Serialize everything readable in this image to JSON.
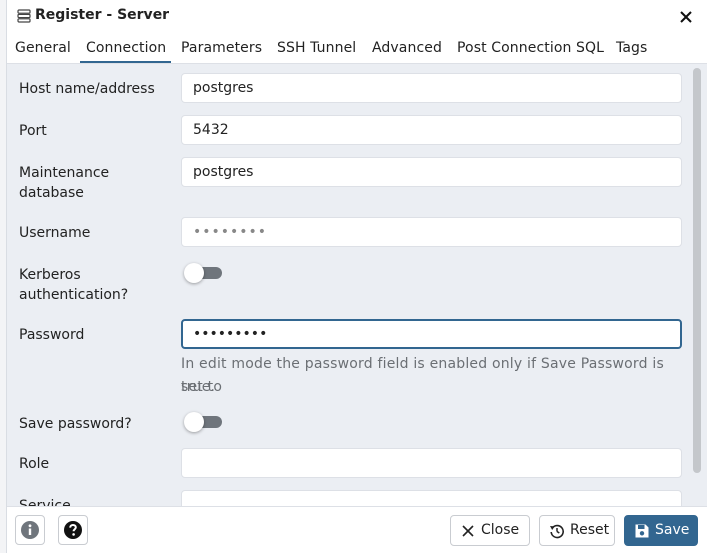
{
  "dialog": {
    "title": "Register - Server"
  },
  "tabs": [
    {
      "label": "General"
    },
    {
      "label": "Connection"
    },
    {
      "label": "Parameters"
    },
    {
      "label": "SSH Tunnel"
    },
    {
      "label": "Advanced"
    },
    {
      "label": "Post Connection SQL"
    },
    {
      "label": "Tags"
    }
  ],
  "active_tab": "Connection",
  "form": {
    "host": {
      "label": "Host name/address",
      "value": "postgres"
    },
    "port": {
      "label": "Port",
      "value": "5432"
    },
    "maintenance_db": {
      "label_line1": "Maintenance",
      "label_line2": "database",
      "value": "postgres"
    },
    "username": {
      "label": "Username",
      "value": "••••••••"
    },
    "kerberos": {
      "label_line1": "Kerberos",
      "label_line2": "authentication?",
      "state": "off"
    },
    "password": {
      "label": "Password",
      "value": "•••••••••",
      "hint_line1": "In edit mode the password field is enabled only if Save Password is set to",
      "hint_line2": "true."
    },
    "save_password": {
      "label": "Save password?",
      "state": "off"
    },
    "role": {
      "label": "Role",
      "value": ""
    },
    "service": {
      "label": "Service",
      "value": ""
    }
  },
  "footer": {
    "info_icon": "info-icon",
    "help_icon": "help-icon",
    "close_label": "Close",
    "reset_label": "Reset",
    "save_label": "Save"
  },
  "colors": {
    "accent": "#326690",
    "panel": "#ebeef3",
    "toggle_off": "#6f757c"
  }
}
